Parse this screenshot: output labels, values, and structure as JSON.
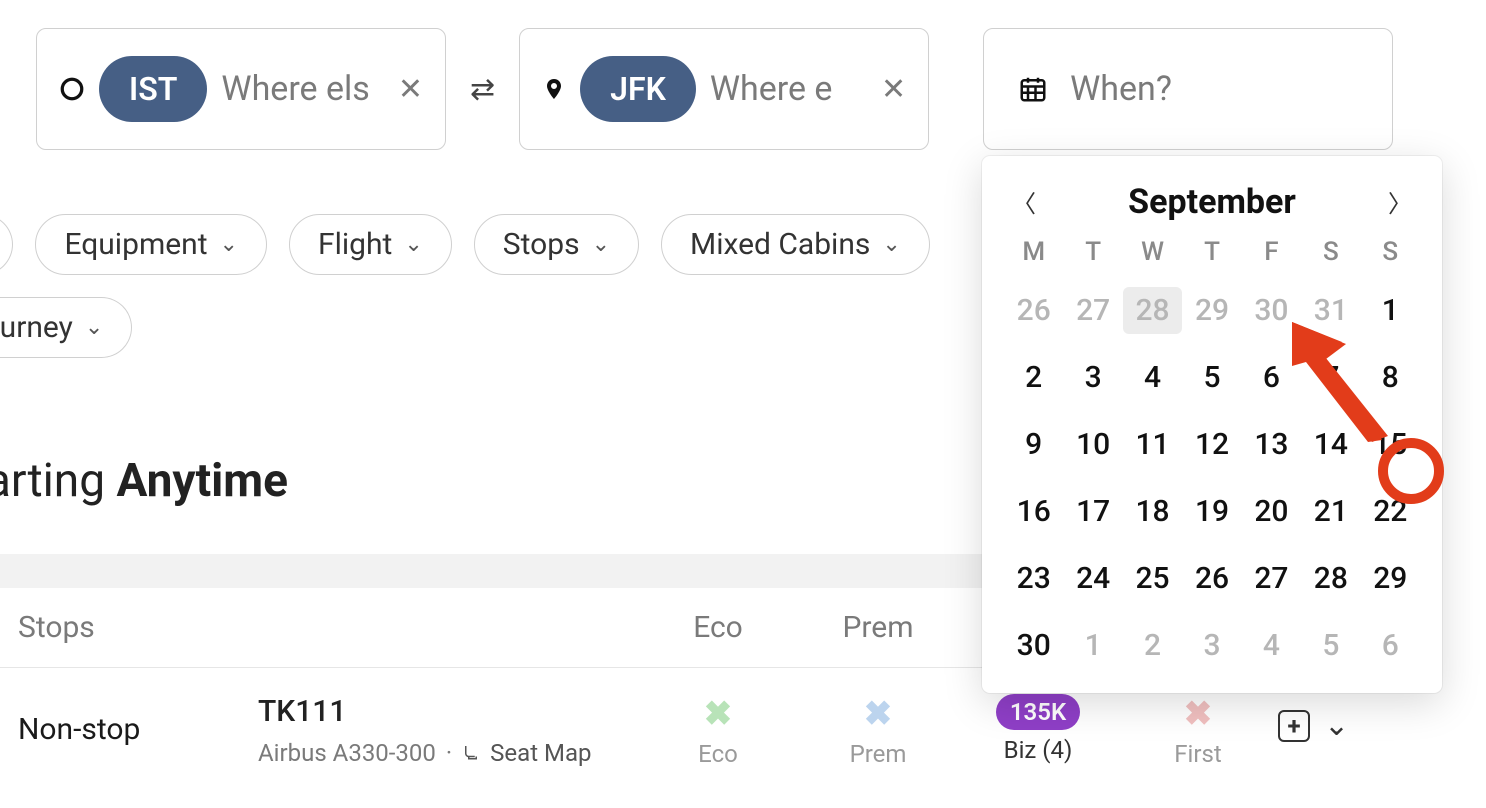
{
  "search": {
    "origin_chip": "IST",
    "origin_placeholder": "Where els",
    "dest_chip": "JFK",
    "dest_placeholder": "Where e",
    "when_placeholder": "When?"
  },
  "filters": {
    "row1_cut": "",
    "equipment": "Equipment",
    "flight": "Flight",
    "stops": "Stops",
    "mixed": "Mixed Cabins",
    "journey": "Journey"
  },
  "heading": {
    "prefix": "parting ",
    "bold": "Anytime"
  },
  "table": {
    "headers": {
      "stops": "Stops",
      "eco": "Eco",
      "prem": "Prem"
    },
    "row": {
      "stops": "Non-stop",
      "flight": "TK111",
      "aircraft": "Airbus A330-300",
      "seatmap": "Seat Map",
      "eco_label": "Eco",
      "prem_label": "Prem",
      "biz_pill": "135K",
      "biz_label": "Biz (4)",
      "first_label": "First"
    }
  },
  "calendar": {
    "month": "September",
    "dow": [
      "M",
      "T",
      "W",
      "T",
      "F",
      "S",
      "S"
    ],
    "weeks": [
      [
        {
          "d": "26",
          "muted": true
        },
        {
          "d": "27",
          "muted": true
        },
        {
          "d": "28",
          "muted": true,
          "today": true
        },
        {
          "d": "29",
          "muted": true
        },
        {
          "d": "30",
          "muted": true
        },
        {
          "d": "31",
          "muted": true
        },
        {
          "d": "1"
        }
      ],
      [
        {
          "d": "2"
        },
        {
          "d": "3"
        },
        {
          "d": "4"
        },
        {
          "d": "5"
        },
        {
          "d": "6"
        },
        {
          "d": "7"
        },
        {
          "d": "8"
        }
      ],
      [
        {
          "d": "9"
        },
        {
          "d": "10"
        },
        {
          "d": "11"
        },
        {
          "d": "12"
        },
        {
          "d": "13"
        },
        {
          "d": "14"
        },
        {
          "d": "15"
        }
      ],
      [
        {
          "d": "16"
        },
        {
          "d": "17"
        },
        {
          "d": "18"
        },
        {
          "d": "19"
        },
        {
          "d": "20"
        },
        {
          "d": "21"
        },
        {
          "d": "22"
        }
      ],
      [
        {
          "d": "23"
        },
        {
          "d": "24"
        },
        {
          "d": "25"
        },
        {
          "d": "26"
        },
        {
          "d": "27"
        },
        {
          "d": "28"
        },
        {
          "d": "29"
        }
      ],
      [
        {
          "d": "30"
        },
        {
          "d": "1",
          "muted": true
        },
        {
          "d": "2",
          "muted": true
        },
        {
          "d": "3",
          "muted": true
        },
        {
          "d": "4",
          "muted": true
        },
        {
          "d": "5",
          "muted": true
        },
        {
          "d": "6",
          "muted": true
        }
      ]
    ]
  }
}
